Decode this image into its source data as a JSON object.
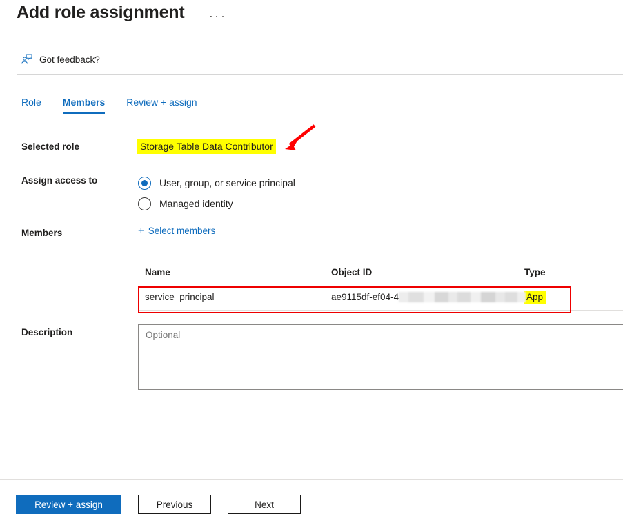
{
  "header": {
    "title": "Add role assignment",
    "more_icon": "ellipsis-icon",
    "feedback_label": "Got feedback?",
    "feedback_icon": "feedback-person-icon"
  },
  "tabs": [
    {
      "label": "Role",
      "active": false
    },
    {
      "label": "Members",
      "active": true
    },
    {
      "label": "Review + assign",
      "active": false
    }
  ],
  "form": {
    "selected_role_label": "Selected role",
    "selected_role_value": "Storage Table Data Contributor",
    "assign_access_label": "Assign access to",
    "assign_access_options": [
      {
        "label": "User, group, or service principal",
        "checked": true
      },
      {
        "label": "Managed identity",
        "checked": false
      }
    ],
    "members_label": "Members",
    "select_members_label": "Select members",
    "select_members_icon": "plus-icon",
    "description_label": "Description",
    "description_value": "",
    "description_placeholder": "Optional"
  },
  "members_table": {
    "columns": [
      "Name",
      "Object ID",
      "Type"
    ],
    "rows": [
      {
        "name": "service_principal",
        "object_id_visible": "ae9115df-ef04-4",
        "object_id_redacted": true,
        "type": "App",
        "type_highlighted": true,
        "row_annotated": true
      }
    ]
  },
  "annotations": {
    "role_highlight_color": "#ffff00",
    "type_highlight_color": "#ffff00",
    "arrow_color": "#ff0000",
    "row_box_color": "#ee0000"
  },
  "footer": {
    "primary_button": "Review + assign",
    "previous_button": "Previous",
    "next_button": "Next"
  }
}
